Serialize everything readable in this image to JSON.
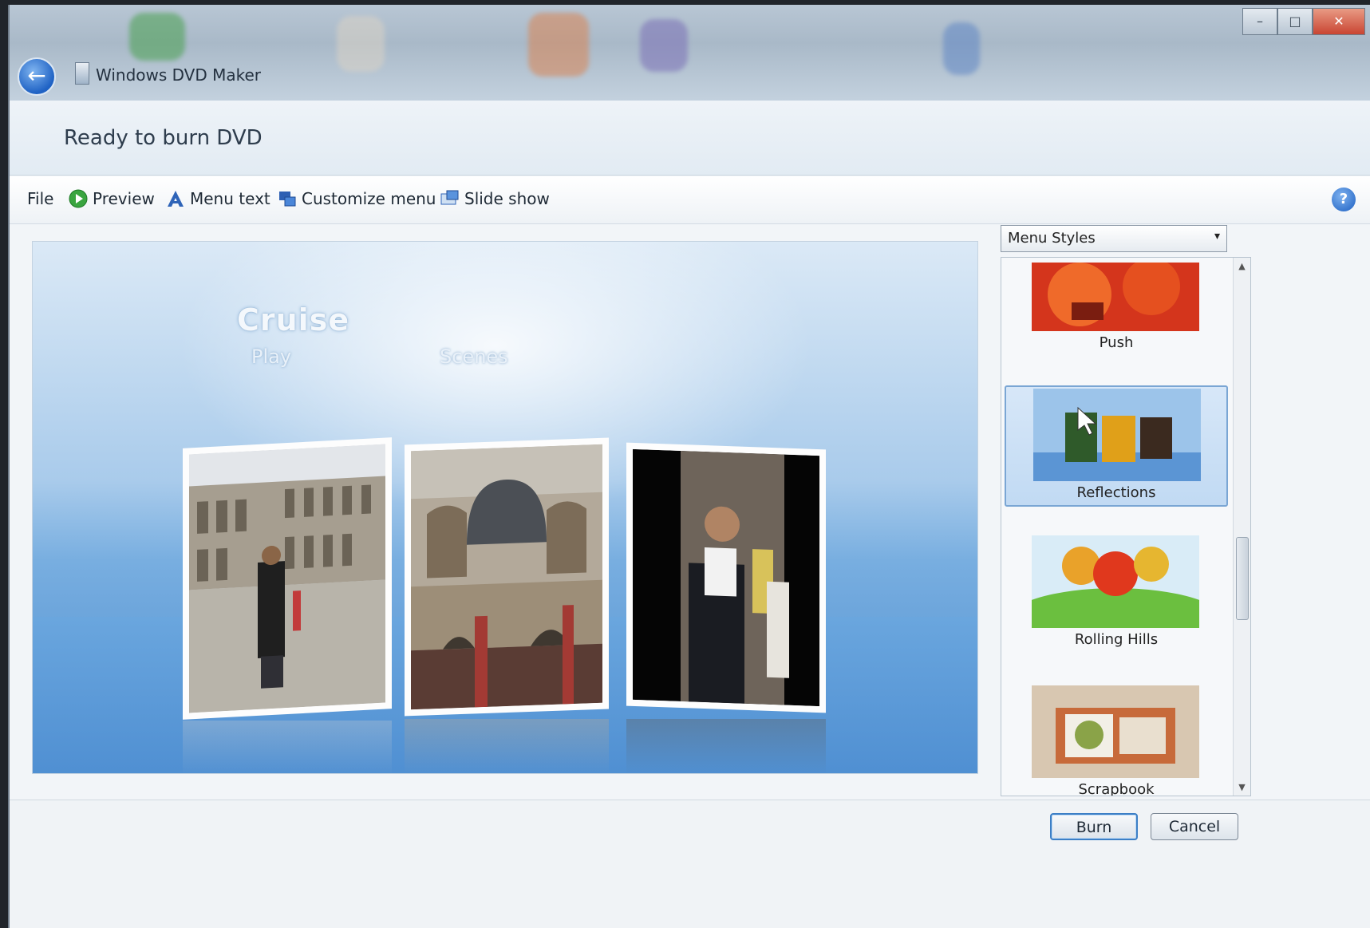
{
  "window": {
    "app_title": "Windows DVD Maker",
    "controls": {
      "minimize": "–",
      "maximize": "□",
      "close": "✕"
    }
  },
  "header": {
    "title": "Ready to burn DVD"
  },
  "toolbar": {
    "file": "File",
    "preview": "Preview",
    "menu_text": "Menu text",
    "customize_menu": "Customize menu",
    "slide_show": "Slide show",
    "help": "?"
  },
  "preview": {
    "disc_title": "Cruise",
    "play": "Play",
    "scenes": "Scenes"
  },
  "sidebar": {
    "dropdown_label": "Menu Styles",
    "dropdown_arrow": "▾",
    "items": [
      {
        "label": "Push",
        "selected": false
      },
      {
        "label": "Reflections",
        "selected": true
      },
      {
        "label": "Rolling Hills",
        "selected": false
      },
      {
        "label": "Scrapbook",
        "selected": false
      }
    ]
  },
  "footer": {
    "burn_label": "Burn",
    "cancel_label": "Cancel"
  },
  "colors": {
    "accent": "#3c7fc6",
    "preview_top": "#dbe9f6",
    "preview_bottom": "#4d8dd0"
  }
}
